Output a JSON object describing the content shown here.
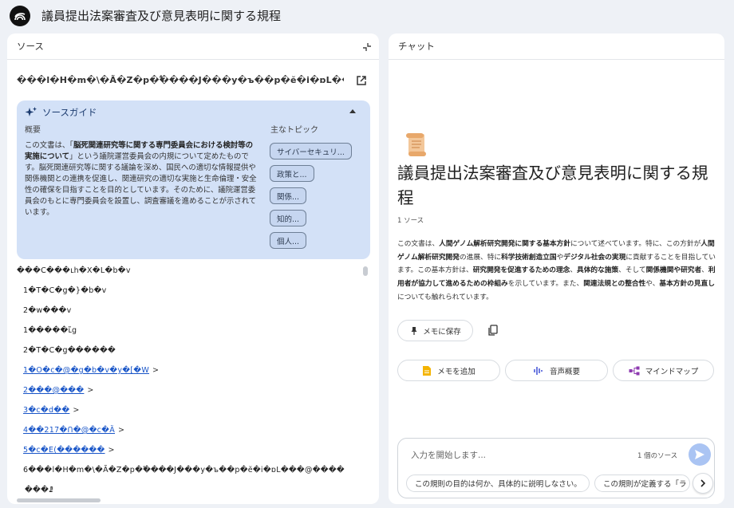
{
  "app": {
    "title": "議員提出法案審査及び意見表明に関する規程"
  },
  "source_panel": {
    "title": "ソース",
    "source_title": "���l�H�m�\\�Ã�Z�p�ؖ����J���y�ъ��p�ӗ�i�ɒL���@����",
    "guide": {
      "title": "ソースガイド",
      "overview_label": "概要",
      "overview_parts": [
        {
          "t": "この文書は、「",
          "b": false
        },
        {
          "t": "脳死関連研究等に関する専門委員会における検討等の実施について",
          "b": true
        },
        {
          "t": "」という議院運営委員会の内規について定めたものです。脳死関連研究等に関する議論を深め、国民への適切な情報提供や関係機関との連携を促進し、関連研究の適切な実施と生命倫理・安全性の確保を目指すことを目的としています。そのために、議院運営委員会のもとに専門委員会を設置し、調査審議を進めることが示されています。",
          "b": false
        }
      ],
      "topics_label": "主なトピック",
      "topics": [
        "サイバーセキュリ...",
        "政策と...",
        "関係...",
        "知的...",
        "個人..."
      ]
    },
    "outline": [
      {
        "text": "���C���ւh�X�L�b�v",
        "link": false,
        "arrow": ""
      },
      {
        "text": "1�T�C�g�}�b�v",
        "link": false,
        "arrow": ""
      },
      {
        "text": "2�w���v",
        "link": false,
        "arrow": ""
      },
      {
        "text": "1�����ւ̃g",
        "link": false,
        "arrow": ""
      },
      {
        "text": "2�T�C�g������",
        "link": false,
        "arrow": ""
      },
      {
        "text": "1�O�c�@�g�b�v�y�[�W",
        "link": true,
        "arrow": ">"
      },
      {
        "text": "2���@���",
        "link": true,
        "arrow": ">"
      },
      {
        "text": "3�c�d��",
        "link": true,
        "arrow": ">"
      },
      {
        "text": "4��217�Ո�@�c�Ȁ",
        "link": true,
        "arrow": ">"
      },
      {
        "text": "5�c�E(������",
        "link": true,
        "arrow": ">"
      },
      {
        "text": "6���l�H�m�\\�Ã�Z�p�ؖ����J���y�ъ��p�ӗ�i�ɒL���@����",
        "link": false,
        "arrow": ""
      },
      {
        "text": "���ꗗ",
        "link": false,
        "arrow": ""
      }
    ]
  },
  "chat_panel": {
    "title": "チャット",
    "doc_title": "議員提出法案審査及び意見表明に関する規程",
    "source_count": "1 ソース",
    "summary_parts": [
      {
        "t": "この文書は、",
        "b": false
      },
      {
        "t": "人間ゲノム解析研究開発に関する基本方針",
        "b": true
      },
      {
        "t": "について述べています。特に、この方針が",
        "b": false
      },
      {
        "t": "人間ゲノム解析研究開発",
        "b": true
      },
      {
        "t": "の進展、特に",
        "b": false
      },
      {
        "t": "科学技術創造立国",
        "b": true
      },
      {
        "t": "や",
        "b": false
      },
      {
        "t": "デジタル社会の実現",
        "b": true
      },
      {
        "t": "に貢献することを目指しています。この基本方針は、",
        "b": false
      },
      {
        "t": "研究開発を促進するための理念",
        "b": true
      },
      {
        "t": "、",
        "b": false
      },
      {
        "t": "具体的な施策",
        "b": true
      },
      {
        "t": "、そして",
        "b": false
      },
      {
        "t": "関係機関や研究者",
        "b": true
      },
      {
        "t": "、",
        "b": false
      },
      {
        "t": "利用者が協力して進めるための枠組み",
        "b": true
      },
      {
        "t": "を示しています。また、",
        "b": false
      },
      {
        "t": "関連法規との整合性",
        "b": true
      },
      {
        "t": "や、",
        "b": false
      },
      {
        "t": "基本方針の見直し",
        "b": true
      },
      {
        "t": "についても触れられています。",
        "b": false
      }
    ],
    "save_note_label": "メモに保存",
    "actions": [
      "メモを追加",
      "音声概要",
      "マインドマップ"
    ],
    "composer": {
      "placeholder": "入力を開始します...",
      "source_count": "1 個のソース"
    },
    "suggestions": [
      "この規則の目的は何か、具体的に説明しなさい。",
      "この規則が定義する「ラ"
    ]
  },
  "colors": {
    "accent": "#1a56c8",
    "guide_bg": "#d3e1f7",
    "send_button": "#aac4f3",
    "note_icon": "#f4b400",
    "audio_icon": "#4a5ad8",
    "mindmap_icon": "#8e3ab0"
  }
}
